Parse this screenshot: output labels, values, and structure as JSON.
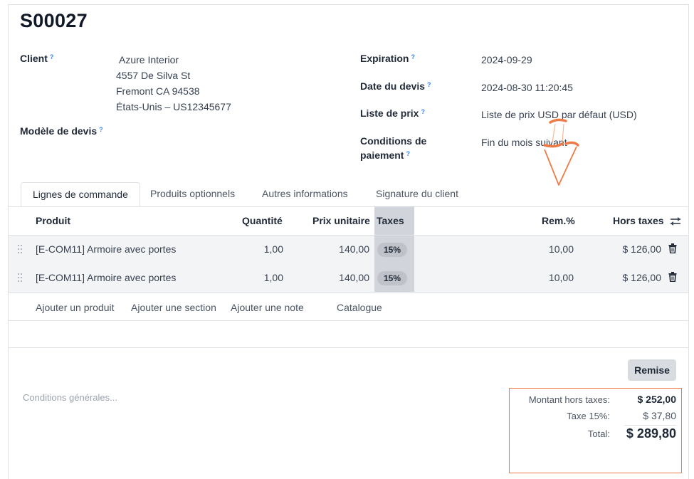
{
  "record": {
    "name": "S00027"
  },
  "fields": {
    "client_label": "Client",
    "client_lines": [
      "Azure Interior",
      "4557 De Silva St",
      "Fremont CA 94538",
      "États-Unis – US12345677"
    ],
    "template_label": "Modèle de devis",
    "expiration_label": "Expiration",
    "expiration_value": "2024-09-29",
    "quote_date_label": "Date du devis",
    "quote_date_value": "2024-08-30 11:20:45",
    "pricelist_label": "Liste de prix",
    "pricelist_value": "Liste de prix USD par défaut (USD)",
    "payment_terms_label_1": "Conditions de",
    "payment_terms_label_2": "paiement",
    "payment_terms_value": "Fin du mois suivant",
    "help_mark": "?"
  },
  "tabs": [
    "Lignes de commande",
    "Produits optionnels",
    "Autres informations",
    "Signature du client"
  ],
  "table": {
    "headers": {
      "product": "Produit",
      "quantity": "Quantité",
      "unit_price": "Prix unitaire",
      "taxes": "Taxes",
      "discount": "Rem.%",
      "subtotal": "Hors taxes"
    },
    "rows": [
      {
        "product": "[E-COM11] Armoire avec portes",
        "quantity": "1,00",
        "unit_price": "140,00",
        "tax": "15%",
        "discount": "10,00",
        "subtotal": "$ 126,00"
      },
      {
        "product": "[E-COM11] Armoire avec portes",
        "quantity": "1,00",
        "unit_price": "140,00",
        "tax": "15%",
        "discount": "10,00",
        "subtotal": "$ 126,00"
      }
    ],
    "links": {
      "add_product": "Ajouter un produit",
      "add_section": "Ajouter une section",
      "add_note": "Ajouter une note",
      "catalog": "Catalogue"
    }
  },
  "terms_placeholder": "Conditions générales...",
  "discount_button": "Remise",
  "totals": {
    "untaxed_label": "Montant hors taxes:",
    "untaxed_value": "$ 252,00",
    "tax_label": "Taxe 15%:",
    "tax_value": "$ 37,80",
    "total_label": "Total:",
    "total_value": "$ 289,80"
  },
  "colors": {
    "accent_orange": "#ee7b46",
    "help_blue": "#3b82f6",
    "row_bg": "#f3f4f6",
    "tax_column_highlight": "#d1d5db"
  }
}
